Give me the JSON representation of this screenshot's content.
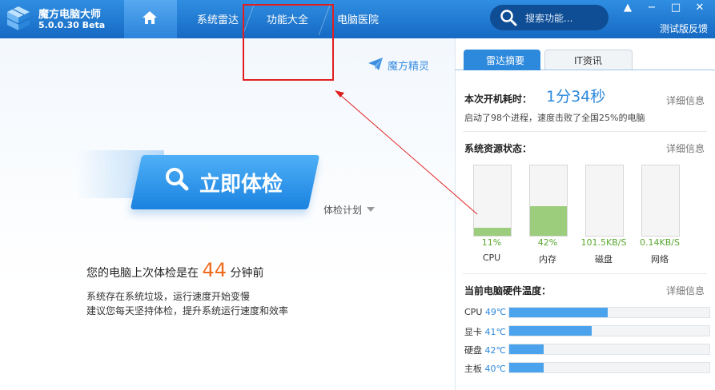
{
  "app": {
    "name": "魔方电脑大师",
    "version": "5.0.0.30 Beta"
  },
  "nav": {
    "home_icon": "home-icon",
    "items": [
      "系统雷达",
      "功能大全",
      "电脑医院"
    ]
  },
  "search": {
    "placeholder": "搜索功能..."
  },
  "window": {
    "minimize": "−",
    "maximize": "□",
    "close": "✕",
    "extra": "▲",
    "feedback": "测试版反馈"
  },
  "left": {
    "sprite_link": "魔方精灵",
    "check_button": "立即体检",
    "plan": "体检计划",
    "last_check_prefix": "您的电脑上次体检是在",
    "last_check_minutes": "44",
    "last_check_suffix": "分钟前",
    "tip1": "系统存在系统垃圾，运行速度开始变慢",
    "tip2": "建议您每天坚持体检，提升系统运行速度和效率"
  },
  "right": {
    "tabs": [
      "雷达摘要",
      "IT资讯"
    ],
    "boot": {
      "label": "本次开机耗时：",
      "time": "1分34秒",
      "detail": "详细信息",
      "desc": "启动了98个进程，速度击败了全国25%的电脑"
    },
    "resources": {
      "label": "系统资源状态：",
      "detail": "详细信息",
      "gauges": [
        {
          "value": "11%",
          "name": "CPU",
          "level": 0.11
        },
        {
          "value": "42%",
          "name": "内存",
          "level": 0.42
        },
        {
          "value": "101.5KB/S",
          "name": "磁盘",
          "level": 0
        },
        {
          "value": "0.14KB/S",
          "name": "网络",
          "level": 0
        }
      ]
    },
    "temps": {
      "label": "当前电脑硬件温度：",
      "detail": "详细信息",
      "rows": [
        {
          "name": "CPU",
          "value": "49℃",
          "level": 0.49
        },
        {
          "name": "显卡",
          "value": "41℃",
          "level": 0.41
        },
        {
          "name": "硬盘",
          "value": "42℃",
          "level": 0.17
        },
        {
          "name": "主板",
          "value": "40℃",
          "level": 0.17
        }
      ]
    }
  },
  "colors": {
    "accent": "#2d89dc",
    "highlight": "#e02020",
    "gauge": "#9ccd7c",
    "number": "#f06c1c"
  }
}
